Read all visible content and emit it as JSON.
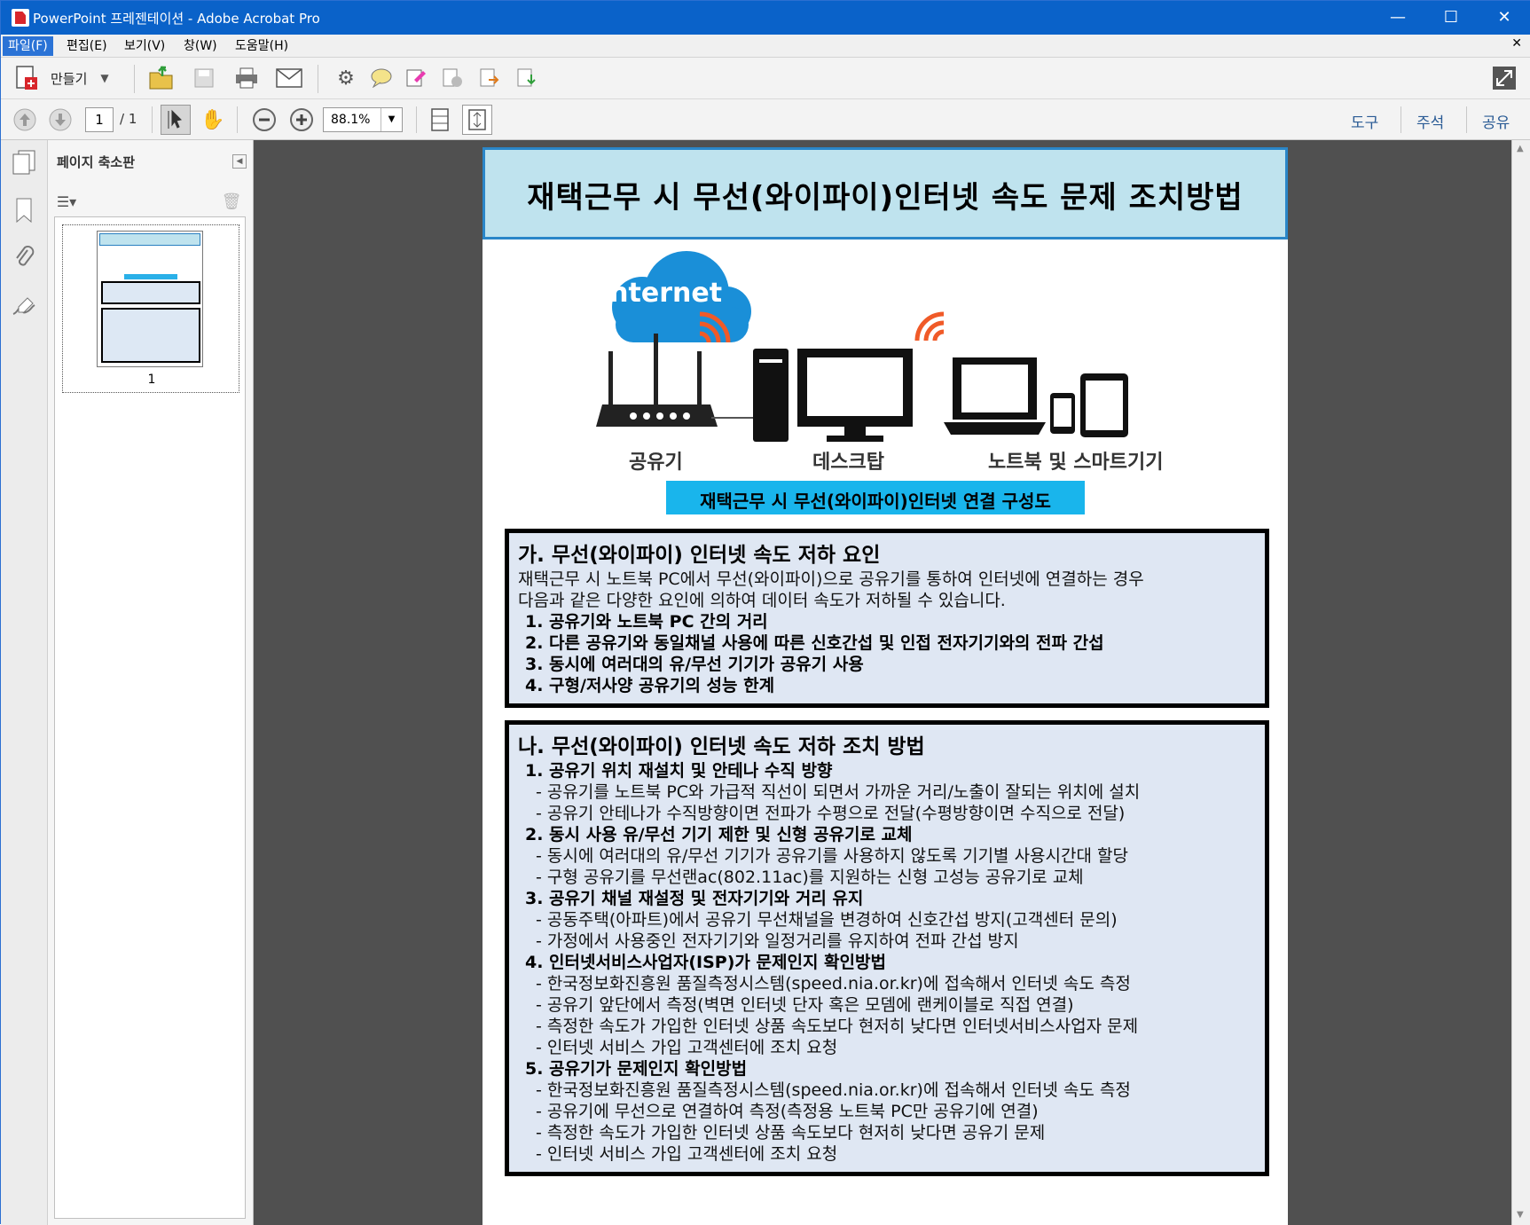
{
  "window": {
    "title": "PowerPoint 프레젠테이션 - Adobe Acrobat Pro"
  },
  "menu": {
    "items": [
      "파일(F)",
      "편집(E)",
      "보기(V)",
      "창(W)",
      "도움말(H)"
    ]
  },
  "toolbar": {
    "create_label": "만들기"
  },
  "nav": {
    "page_current": "1",
    "page_total": "/ 1",
    "zoom": "88.1%",
    "tools": "도구",
    "comment": "주석",
    "share": "공유"
  },
  "sidepanel": {
    "title": "페이지 축소판",
    "thumb_number": "1"
  },
  "document": {
    "title": "재택근무 시 무선(와이파이)인터넷 속도 문제 조치방법",
    "diagram_labels": {
      "internet": "Internet",
      "router": "공유기",
      "desktop": "데스크탑",
      "laptop": "노트북 및 스마트기기"
    },
    "diagram_caption": "재택근무 시 무선(와이파이)인터넷 연결 구성도",
    "section_a": {
      "heading": "가. 무선(와이파이) 인터넷 속도 저하 요인",
      "intro1": "재택근무 시 노트북 PC에서 무선(와이파이)으로 공유기를 통하여 인터넷에 연결하는 경우",
      "intro2": "다음과 같은 다양한 요인에 의하여 데이터 속도가 저하될 수 있습니다.",
      "items": [
        "1. 공유기와 노트북 PC 간의 거리",
        "2. 다른 공유기와 동일채널 사용에 따른 신호간섭 및 인접 전자기기와의 전파 간섭",
        "3. 동시에 여러대의 유/무선 기기가 공유기 사용",
        "4. 구형/저사양 공유기의 성능 한계"
      ]
    },
    "section_b": {
      "heading": "나. 무선(와이파이) 인터넷 속도 저하 조치 방법",
      "item1": "1. 공유기 위치 재설치 및 안테나 수직 방향",
      "item1_sub1": "- 공유기를 노트북 PC와 가급적 직선이 되면서 가까운 거리/노출이 잘되는 위치에 설치",
      "item1_sub2": "- 공유기 안테나가 수직방향이면 전파가 수평으로 전달(수평방향이면 수직으로 전달)",
      "item2": "2. 동시 사용 유/무선 기기 제한 및 신형 공유기로 교체",
      "item2_sub1": "- 동시에 여러대의 유/무선 기기가 공유기를 사용하지 않도록 기기별 사용시간대 할당",
      "item2_sub2": "- 구형 공유기를 무선랜ac(802.11ac)를 지원하는 신형 고성능 공유기로 교체",
      "item3": "3. 공유기 채널 재설정 및 전자기기와 거리 유지",
      "item3_sub1": "- 공동주택(아파트)에서 공유기 무선채널을 변경하여 신호간섭 방지(고객센터 문의)",
      "item3_sub2": "- 가정에서 사용중인 전자기기와 일정거리를 유지하여 전파 간섭 방지",
      "item4": "4. 인터넷서비스사업자(ISP)가 문제인지 확인방법",
      "item4_sub1": "- 한국정보화진흥원 품질측정시스템(speed.nia.or.kr)에 접속해서 인터넷 속도 측정",
      "item4_sub2": "- 공유기 앞단에서 측정(벽면 인터넷 단자 혹은 모뎀에 랜케이블로 직접 연결)",
      "item4_sub3": "- 측정한 속도가 가입한 인터넷 상품 속도보다 현저히 낮다면 인터넷서비스사업자 문제",
      "item4_sub4": "- 인터넷 서비스 가입 고객센터에 조치 요청",
      "item5": "5. 공유기가 문제인지 확인방법",
      "item5_sub1": "- 한국정보화진흥원 품질측정시스템(speed.nia.or.kr)에 접속해서 인터넷 속도 측정",
      "item5_sub2": "- 공유기에 무선으로 연결하여 측정(측정용 노트북 PC만 공유기에 연결)",
      "item5_sub3": "- 측정한 속도가 가입한 인터넷 상품 속도보다 현저히 낮다면 공유기 문제",
      "item5_sub4": "- 인터넷 서비스 가입 고객센터에 조치 요청"
    }
  },
  "colors": {
    "titlebar": "#0a62c9",
    "title_box_bg": "#bfe3ee",
    "caption_bg": "#19b5ec",
    "section_bg": "#dfe7f3",
    "cloud": "#1a8fd8",
    "wifi": "#f05a28"
  }
}
